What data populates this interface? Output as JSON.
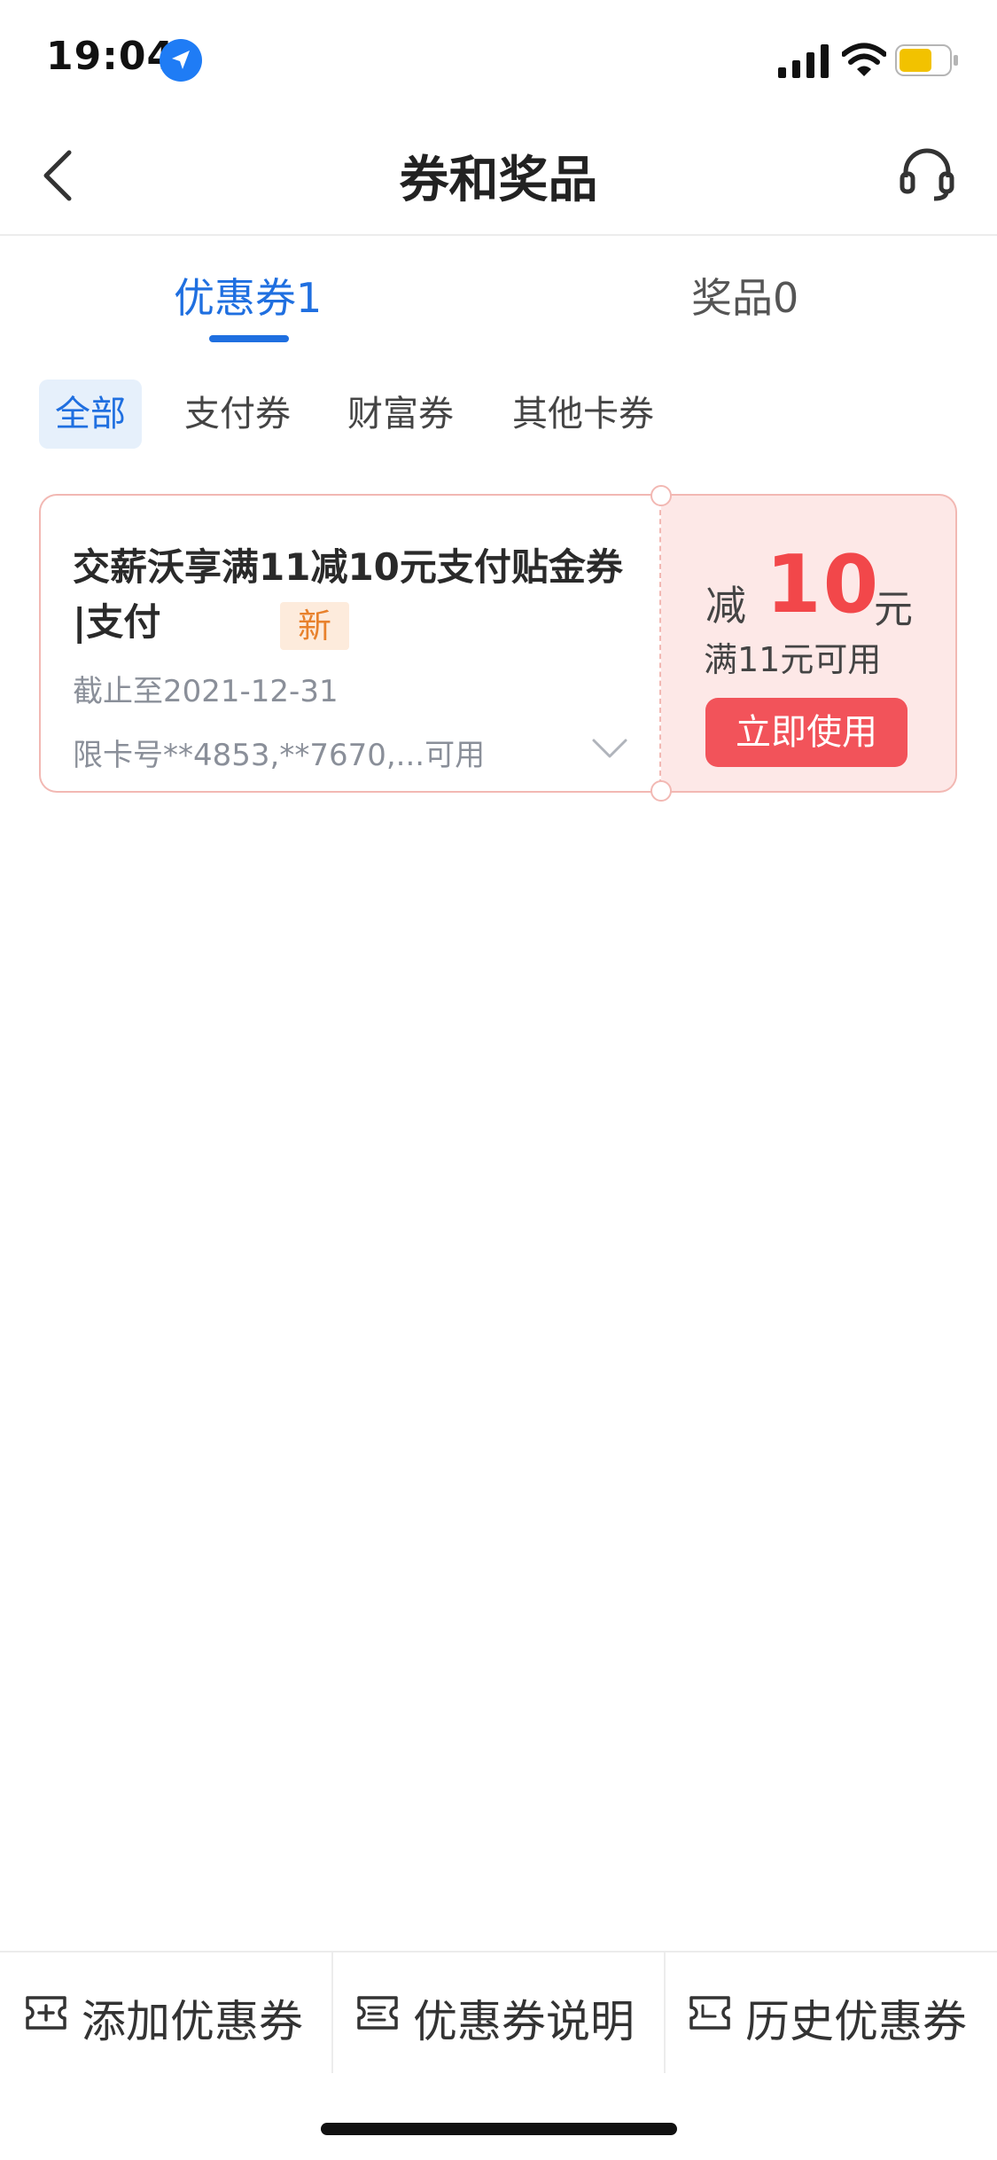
{
  "status_bar": {
    "time": "19:04",
    "icons": [
      "location-arrow-icon",
      "signal-icon",
      "wifi-icon",
      "battery-icon"
    ]
  },
  "nav": {
    "title": "券和奖品",
    "back_icon": "chevron-left-icon",
    "service_icon": "headset-icon"
  },
  "main_tabs": [
    {
      "label": "优惠券1",
      "active": true
    },
    {
      "label": "奖品0",
      "active": false
    }
  ],
  "filters": [
    {
      "label": "全部",
      "active": true
    },
    {
      "label": "支付券",
      "active": false
    },
    {
      "label": "财富券",
      "active": false
    },
    {
      "label": "其他卡券",
      "active": false
    }
  ],
  "coupon": {
    "title": "交薪沃享满11减10元支付贴金券 |支付",
    "badge": "新",
    "expiry": "截止至2021-12-31",
    "cards": "限卡号**4853,**7670,...可用",
    "reduce_prefix": "减",
    "amount": "10",
    "unit": "元",
    "threshold": "满11元可用",
    "button": "立即使用"
  },
  "bottom_bar": [
    {
      "label": "添加优惠券",
      "icon": "add-ticket-icon"
    },
    {
      "label": "优惠券说明",
      "icon": "ticket-info-icon"
    },
    {
      "label": "历史优惠券",
      "icon": "ticket-history-icon"
    }
  ],
  "colors": {
    "accent": "#1f6fe0",
    "coupon_red": "#f2474a",
    "coupon_bg": "#fde8e7",
    "badge_orange": "#e8812c"
  }
}
